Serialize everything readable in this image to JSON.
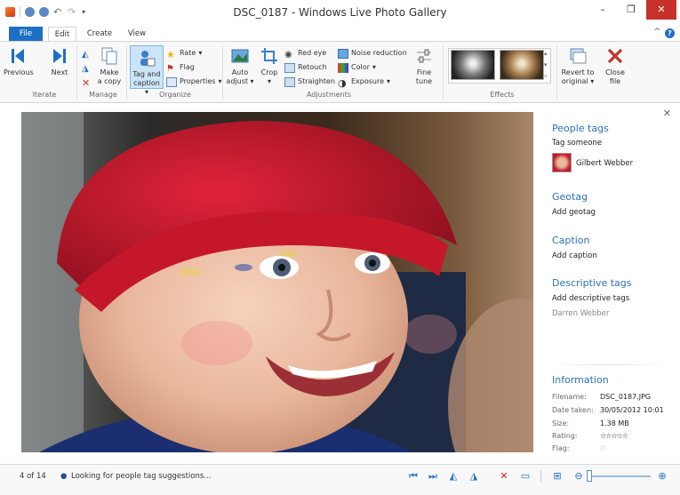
{
  "window": {
    "title": "DSC_0187 - Windows Live Photo Gallery"
  },
  "tabs": [
    "File",
    "Edit",
    "Create",
    "View"
  ],
  "ribbon": {
    "iterate": {
      "previous": "Previous",
      "next": "Next",
      "label": "Iterate"
    },
    "manage": {
      "make_copy_1": "Make",
      "make_copy_2": "a copy",
      "label": "Manage"
    },
    "organize": {
      "tag_1": "Tag and",
      "tag_2": "caption",
      "rate": "Rate",
      "flag": "Flag",
      "properties": "Properties",
      "label": "Organize"
    },
    "adjustments": {
      "auto_1": "Auto",
      "auto_2": "adjust",
      "crop": "Crop",
      "red_eye": "Red eye",
      "retouch": "Retouch",
      "straighten": "Straighten",
      "noise": "Noise reduction",
      "color": "Color",
      "exposure": "Exposure",
      "fine_1": "Fine",
      "fine_2": "tune",
      "label": "Adjustments"
    },
    "effects": {
      "label": "Effects"
    },
    "revert": {
      "revert_1": "Revert to",
      "revert_2": "original",
      "close_1": "Close",
      "close_2": "file"
    }
  },
  "panel": {
    "people_tags": "People tags",
    "tag_someone": "Tag someone",
    "person": "Gilbert Webber",
    "geotag": "Geotag",
    "add_geotag": "Add geotag",
    "caption": "Caption",
    "add_caption": "Add caption",
    "descriptive_tags": "Descriptive tags",
    "add_descriptive": "Add descriptive tags",
    "desc_tag": "Darren Webber",
    "information": "Information",
    "info": {
      "filename_k": "Filename:",
      "filename_v": "DSC_0187.JPG",
      "date_k": "Date taken:",
      "date_v": "30/05/2012  10:01",
      "size_k": "Size:",
      "size_v": "1.38 MB",
      "rating_k": "Rating:",
      "rating_v": "☆☆☆☆☆",
      "flag_k": "Flag:"
    }
  },
  "status": {
    "position": "4 of 14",
    "message": "Looking for people tag suggestions..."
  },
  "colors": {
    "accent": "#1e6fc6",
    "close": "#c7312b",
    "heading": "#2a71b9"
  }
}
